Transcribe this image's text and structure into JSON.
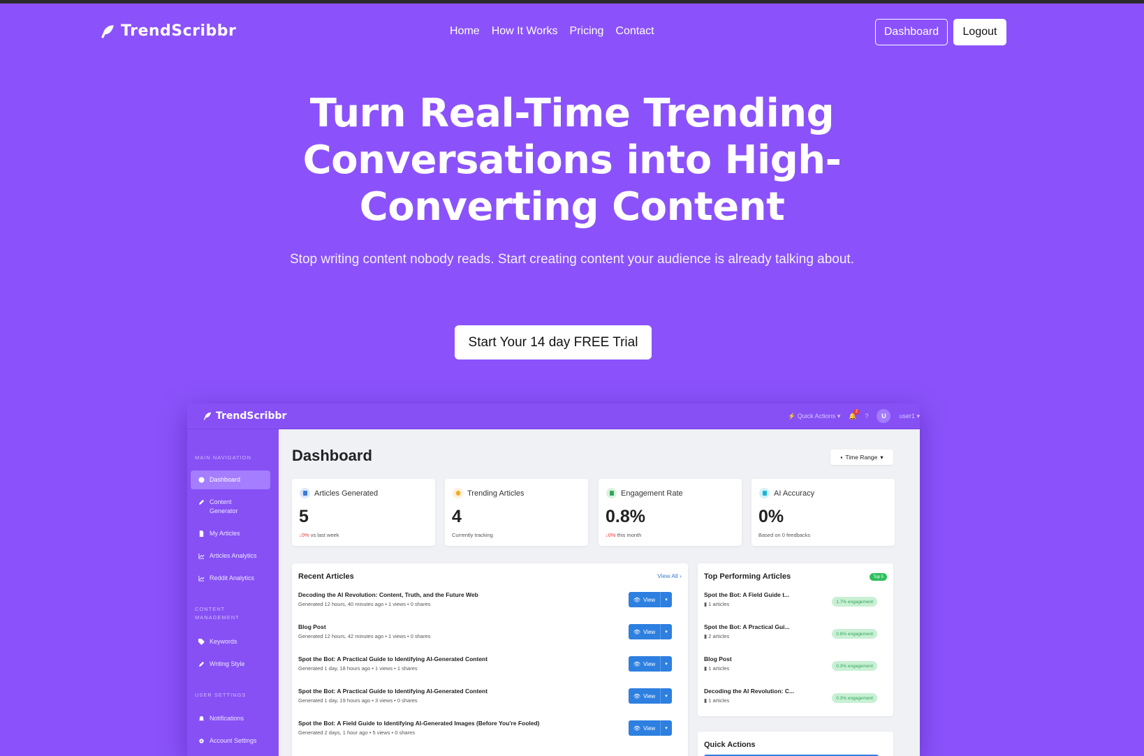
{
  "brand": {
    "name": "TrendScribbr"
  },
  "nav": {
    "links": [
      "Home",
      "How It Works",
      "Pricing",
      "Contact"
    ],
    "dashboard_label": "Dashboard",
    "logout_label": "Logout"
  },
  "hero": {
    "title": "Turn Real-Time Trending Conversations into High-Converting Content",
    "subtitle": "Stop writing content nobody reads. Start creating content your audience is already talking about.",
    "cta_label": "Start Your 14 day FREE Trial"
  },
  "preview": {
    "brand": "TrendScribbr",
    "topbar": {
      "quick_actions": "Quick Actions",
      "notif_count": "2",
      "user_initial": "U",
      "username": "user1"
    },
    "sidebar": {
      "sections": [
        {
          "title": "MAIN NAVIGATION",
          "items": [
            "Dashboard",
            "Content Generator",
            "My Articles",
            "Articles Analytics",
            "Reddit Analytics"
          ]
        },
        {
          "title": "CONTENT MANAGEMENT",
          "items": [
            "Keywords",
            "Writing Style"
          ]
        },
        {
          "title": "USER SETTINGS",
          "items": [
            "Notifications",
            "Account Settings"
          ]
        }
      ]
    },
    "main": {
      "title": "Dashboard",
      "time_range": "Time Range",
      "stats": [
        {
          "label": "Articles Generated",
          "value": "5",
          "delta": "0%",
          "note": "vs last week",
          "color": "#3a7bd5"
        },
        {
          "label": "Trending Articles",
          "value": "4",
          "delta": "",
          "note": "Currently tracking",
          "color": "#f5a623"
        },
        {
          "label": "Engagement Rate",
          "value": "0.8%",
          "delta": "0%",
          "note": "this month",
          "color": "#34a55a"
        },
        {
          "label": "AI Accuracy",
          "value": "0%",
          "delta": "",
          "note": "Based on 0 feedbacks",
          "color": "#19b5d9"
        }
      ],
      "recent": {
        "title": "Recent Articles",
        "view_all": "View All",
        "view_label": "View",
        "rows": [
          {
            "title": "Decoding the AI Revolution: Content, Truth, and the Future Web",
            "meta": "Generated 12 hours, 40 minutes ago • 1 views • 0 shares"
          },
          {
            "title": "Blog Post",
            "meta": "Generated 12 hours, 42 minutes ago • 1 views • 0 shares"
          },
          {
            "title": "Spot the Bot: A Practical Guide to Identifying AI-Generated Content",
            "meta": "Generated 1 day, 18 hours ago • 1 views • 1 shares"
          },
          {
            "title": "Spot the Bot: A Practical Guide to Identifying AI-Generated Content",
            "meta": "Generated 1 day, 19 hours ago • 3 views • 0 shares"
          },
          {
            "title": "Spot the Bot: A Field Guide to Identifying AI-Generated Images (Before You're Fooled)",
            "meta": "Generated 2 days, 1 hour ago • 5 views • 0 shares"
          }
        ]
      },
      "top": {
        "title": "Top Performing Articles",
        "badge": "Top 5",
        "rows": [
          {
            "name": "Spot the Bot: A Field Guide t...",
            "count": "1 articles",
            "engagement": "1.7% engagement"
          },
          {
            "name": "Spot the Bot: A Practical Gui...",
            "count": "2 articles",
            "engagement": "0.8% engagement"
          },
          {
            "name": "Blog Post",
            "count": "1 articles",
            "engagement": "0.3% engagement"
          },
          {
            "name": "Decoding the AI Revolution: C...",
            "count": "1 articles",
            "engagement": "0.3% engagement"
          }
        ]
      },
      "quick_actions": {
        "title": "Quick Actions"
      }
    }
  }
}
